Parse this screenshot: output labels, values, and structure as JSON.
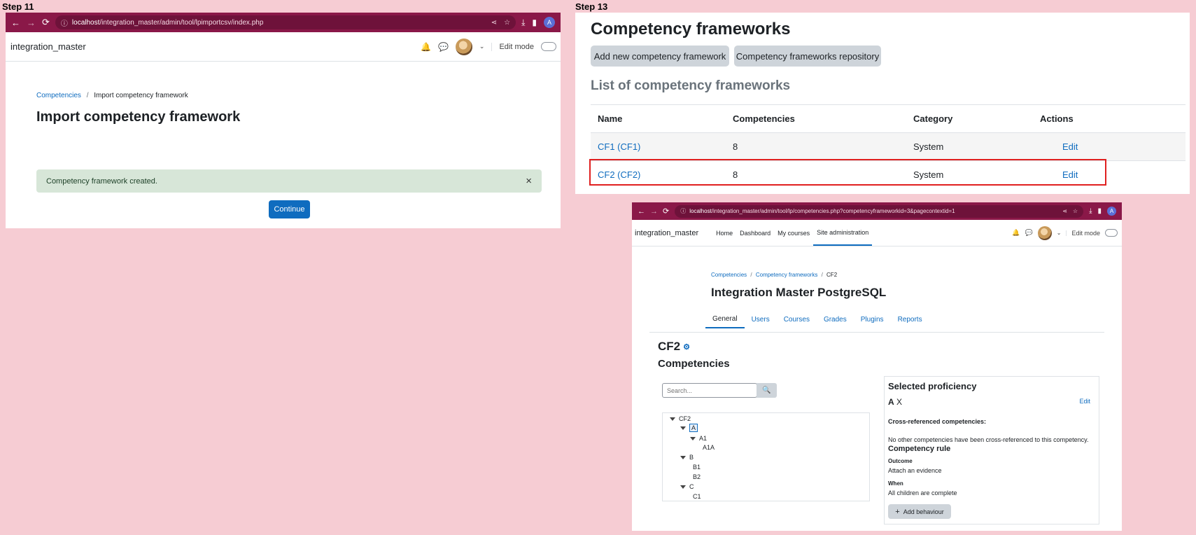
{
  "steps": {
    "step11": "Step 11",
    "step13": "Step 13"
  },
  "panel1": {
    "browser": {
      "url_host": "localhost",
      "url_path": "/integration_master/admin/tool/lpimportcsv/index.php",
      "profile_initial": "A"
    },
    "navbar": {
      "brand": "integration_master",
      "edit_mode_label": "Edit mode"
    },
    "breadcrumb": {
      "link": "Competencies",
      "separator": "/",
      "current": "Import competency framework"
    },
    "page_title": "Import competency framework",
    "alert": {
      "message": "Competency framework created.",
      "close": "×"
    },
    "continue_label": "Continue"
  },
  "panel2": {
    "title": "Competency frameworks",
    "buttons": {
      "add_new": "Add new competency framework",
      "repository": "Competency frameworks repository"
    },
    "list_heading": "List of competency frameworks",
    "table": {
      "headers": [
        "Name",
        "Competencies",
        "Category",
        "Actions"
      ],
      "rows": [
        {
          "name": "CF1 (CF1)",
          "competencies": "8",
          "category": "System",
          "action": "Edit"
        },
        {
          "name": "CF2 (CF2)",
          "competencies": "8",
          "category": "System",
          "action": "Edit"
        }
      ]
    }
  },
  "panel3": {
    "browser": {
      "url_host": "localhost",
      "url_path": "/integration_master/admin/tool/lp/competencies.php?competencyframeworkid=3&pagecontextid=1",
      "profile_initial": "A"
    },
    "navbar": {
      "brand": "integration_master",
      "menu": [
        "Home",
        "Dashboard",
        "My courses",
        "Site administration"
      ],
      "edit_mode_label": "Edit mode"
    },
    "breadcrumb": {
      "items": [
        "Competencies",
        "Competency frameworks",
        "CF2"
      ],
      "separator": "/"
    },
    "site_title": "Integration Master PostgreSQL",
    "tabs": [
      "General",
      "Users",
      "Courses",
      "Grades",
      "Plugins",
      "Reports"
    ],
    "framework_name": "CF2",
    "competencies_heading": "Competencies",
    "search_placeholder": "Search...",
    "tree": {
      "root": "CF2",
      "a": "A",
      "a1": "A1",
      "a1a": "A1A",
      "b": "B",
      "b1": "B1",
      "b2": "B2",
      "c": "C",
      "c1": "C1"
    },
    "selected": {
      "heading": "Selected proficiency",
      "name_bold": "A",
      "name_rest": "X",
      "edit": "Edit",
      "cross_ref_label": "Cross-referenced competencies:",
      "cross_ref_text": "No other competencies have been cross-referenced to this competency.",
      "rule_heading": "Competency rule",
      "outcome_label": "Outcome",
      "outcome_value": "Attach an evidence",
      "when_label": "When",
      "when_value": "All children are complete",
      "add_behaviour": "Add behaviour"
    }
  }
}
